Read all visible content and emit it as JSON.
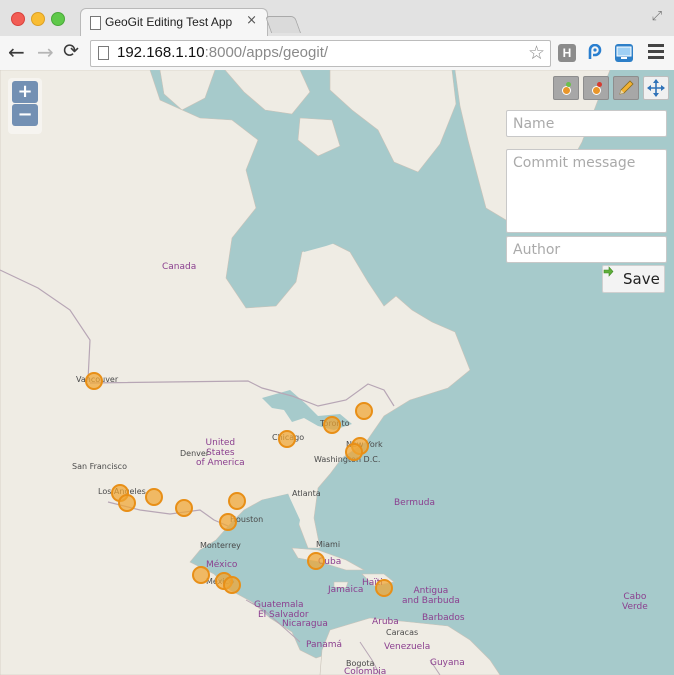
{
  "browser": {
    "tab_title": "GeoGit Editing Test App",
    "tab_close": "×",
    "url_host": "192.168.1.10",
    "url_rest": ":8000/apps/geogit/",
    "back_icon": "←",
    "forward_icon": "→",
    "reload_icon": "⟳",
    "bookmark_icon": "☆",
    "fullscreen_icon": "⤢",
    "extension_h_label": "H"
  },
  "map": {
    "zoom_in_label": "+",
    "zoom_out_label": "−",
    "countries": [
      "Canada",
      "United States of America",
      "México",
      "Guatemala",
      "El Salvador",
      "Nicaragua",
      "Panamá",
      "Cuba",
      "Jamaica",
      "Haïti",
      "Bermuda",
      "Antigua and Barbuda",
      "Barbados",
      "Aruba",
      "Venezuela",
      "Colombia",
      "Guyana",
      "Cabo Verde"
    ],
    "country_labels": {
      "canada": "Canada",
      "usa_1": "United",
      "usa_2": "States",
      "usa_3": "of America",
      "mexico": "México",
      "guatemala": "Guatemala",
      "el_salvador": "El Salvador",
      "nicaragua": "Nicaragua",
      "panama": "Panamá",
      "cuba": "Cuba",
      "jamaica": "Jamaica",
      "haiti": "Haïti",
      "bermuda": "Bermuda",
      "antigua_1": "Antigua",
      "antigua_2": "and Barbuda",
      "barbados": "Barbados",
      "aruba": "Aruba",
      "venezuela": "Venezuela",
      "guyana": "Guyana",
      "cabo_verde_1": "Cabo",
      "cabo_verde_2": "Verde",
      "colombia": "Colombia"
    },
    "city_labels": {
      "vancouver": "Vancouver",
      "san_francisco": "San Francisco",
      "los_angeles": "Los Angeles",
      "denver": "Denver",
      "chicago": "Chicago",
      "toronto": "Toronto",
      "new_york": "New York",
      "washington": "Washington D.C.",
      "atlanta": "Atlanta",
      "houston": "Houston",
      "monterrey": "Monterrey",
      "mexico_city": "México",
      "miami": "Miami",
      "caracas": "Caracas",
      "bogota": "Bogota"
    }
  },
  "editor": {
    "name_placeholder": "Name",
    "commit_placeholder": "Commit message",
    "author_placeholder": "Author",
    "save_label": "Save",
    "save_icon": "➡"
  },
  "colors": {
    "ocean": "#a6cacb",
    "land": "#efece4",
    "border": "#b7a6b5",
    "marker_fill": "#f0a532",
    "marker_stroke": "#e88f17",
    "country_label": "#8b3f8f",
    "zoom_button": "#7390b3"
  }
}
